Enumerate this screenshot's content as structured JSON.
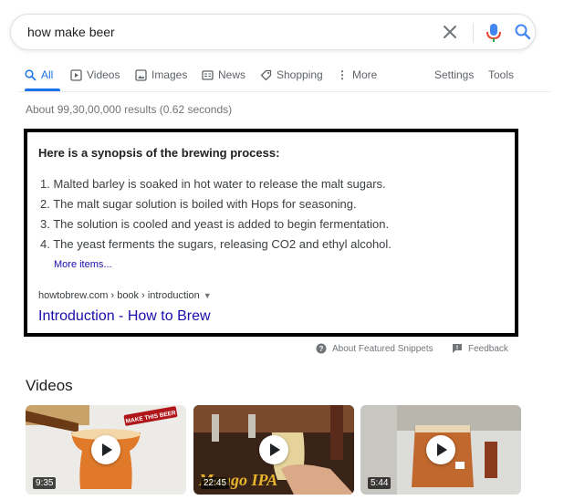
{
  "search": {
    "query": "how make beer"
  },
  "tabs": {
    "all": "All",
    "videos": "Videos",
    "images": "Images",
    "news": "News",
    "shopping": "Shopping",
    "more": "More",
    "settings": "Settings",
    "tools": "Tools"
  },
  "result_stats": "About 99,30,00,000 results (0.62 seconds)",
  "featured_snippet": {
    "heading": "Here is a synopsis of the brewing process:",
    "items": [
      "1. Malted barley is soaked in hot water to release the malt sugars.",
      "2. The malt sugar solution is boiled with Hops for seasoning.",
      "3. The solution is cooled and yeast is added to begin fermentation.",
      "4. The yeast ferments the sugars, releasing CO2 and ethyl alcohol."
    ],
    "more_items": "More items...",
    "cite": "howtobrew.com › book › introduction",
    "title": "Introduction - How to Brew"
  },
  "snippet_footer": {
    "about": "About Featured Snippets",
    "feedback": "Feedback"
  },
  "videos": {
    "heading": "Videos",
    "cards": [
      {
        "duration": "9:35",
        "overlay_text": "MAKE THIS BEER"
      },
      {
        "duration": "22:45",
        "overlay_text": "Mango IPA"
      },
      {
        "duration": "5:44"
      }
    ]
  },
  "colors": {
    "link": "#1a0dab",
    "accent": "#1a73e8",
    "muted": "#70757a"
  }
}
